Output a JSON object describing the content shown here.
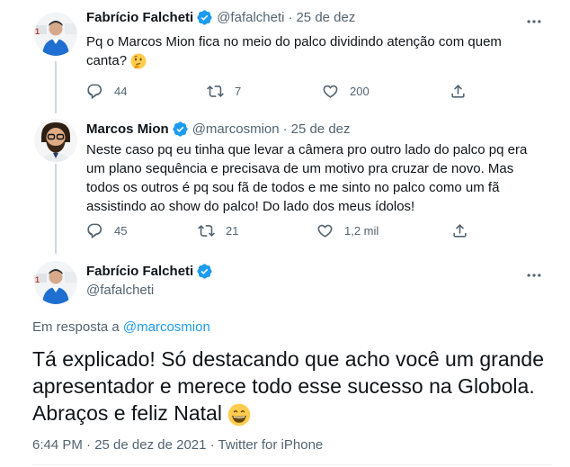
{
  "tweets": [
    {
      "name": "Fabrício Falcheti",
      "handle": "@fafalcheti",
      "time": "25 de dez",
      "text": "Pq o Marcos Mion fica no meio do palco dividindo atenção com quem canta?",
      "emoji": "thinking-face",
      "replies": "44",
      "retweets": "7",
      "likes": "200"
    },
    {
      "name": "Marcos Mion",
      "handle": "@marcosmion",
      "time": "25 de dez",
      "text": "Neste caso pq eu tinha que levar a câmera pro outro lado do palco pq era um plano sequência e precisava de um motivo pra cruzar de novo. Mas todos os outros é pq sou fã de todos e me sinto no palco como um fã assistindo ao show do palco! Do lado dos meus ídolos!",
      "replies": "45",
      "retweets": "21",
      "likes": "1,2 mil"
    }
  ],
  "main": {
    "name": "Fabrício Falcheti",
    "handle": "@fafalcheti",
    "reply_prefix": "Em resposta a",
    "reply_handle": "@marcosmion",
    "text": "Tá explicado! Só destacando que acho você um grande apresentador e merece todo esse sucesso na Globola. Abraços e feliz Natal",
    "emoji": "grinning-face",
    "timestamp": "6:44 PM · 25 de dez de 2021 · Twitter for iPhone"
  },
  "colors": {
    "verified": "#1d9bf0",
    "link": "#1d9bf0",
    "secondary": "#536471",
    "thread_line": "#cfd9de"
  }
}
